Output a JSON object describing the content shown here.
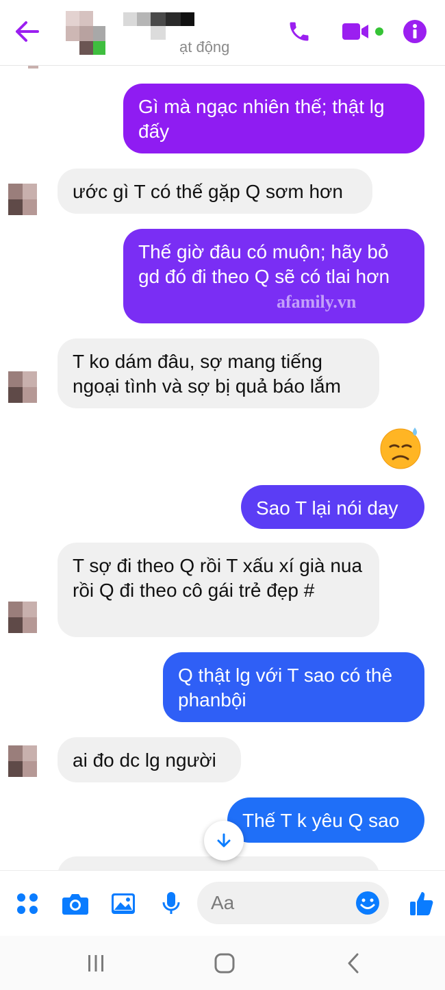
{
  "header": {
    "status_text": "ạt động",
    "accent_color": "#9b1ff0"
  },
  "messages": [
    {
      "id": "m1",
      "side": "out",
      "text": "Gì mà ngạc nhiên thế; thật lg đấy",
      "color": "#8f1cf2"
    },
    {
      "id": "m2",
      "side": "in",
      "text": "ước gì T có thế gặp Q sơm hơn"
    },
    {
      "id": "m3",
      "side": "out",
      "text": "Thế giờ đâu có muộn; hãy bỏ gd đó đi theo Q sẽ có tlai hơn",
      "color": "#7a2ef4"
    },
    {
      "id": "m4",
      "side": "in",
      "text": "T ko dám đâu, sợ mang tiếng ngoại tình và sợ bị quả báo lắm"
    },
    {
      "id": "m5",
      "side": "out",
      "text": "😓",
      "kind": "emoji"
    },
    {
      "id": "m6",
      "side": "out",
      "text": "Sao T lại nói day",
      "color": "#5b3df5"
    },
    {
      "id": "m7",
      "side": "in",
      "text": "T sợ đi theo Q rồi T xấu xí già nua rồi Q đi theo cô gái trẻ đẹp #"
    },
    {
      "id": "m8",
      "side": "out",
      "text": "Q thật lg với T sao có thê phanbội",
      "color": "#2f5ff6"
    },
    {
      "id": "m9",
      "side": "in",
      "text": "ai đo dc lg người"
    },
    {
      "id": "m10",
      "side": "out",
      "text": "Thế T k yêu Q sao",
      "color": "#1f6ff8"
    }
  ],
  "watermark": "afamily.vn",
  "composer": {
    "placeholder": "Aa",
    "icon_color": "#0a7cff"
  },
  "icons": {
    "back": "arrow-left-icon",
    "call": "phone-icon",
    "video": "video-camera-icon",
    "info": "info-icon",
    "menu": "four-dots-icon",
    "camera": "camera-icon",
    "image": "image-icon",
    "mic": "microphone-icon",
    "emoji": "smiley-icon",
    "like": "thumbs-up-icon",
    "scroll": "arrow-down-icon"
  }
}
